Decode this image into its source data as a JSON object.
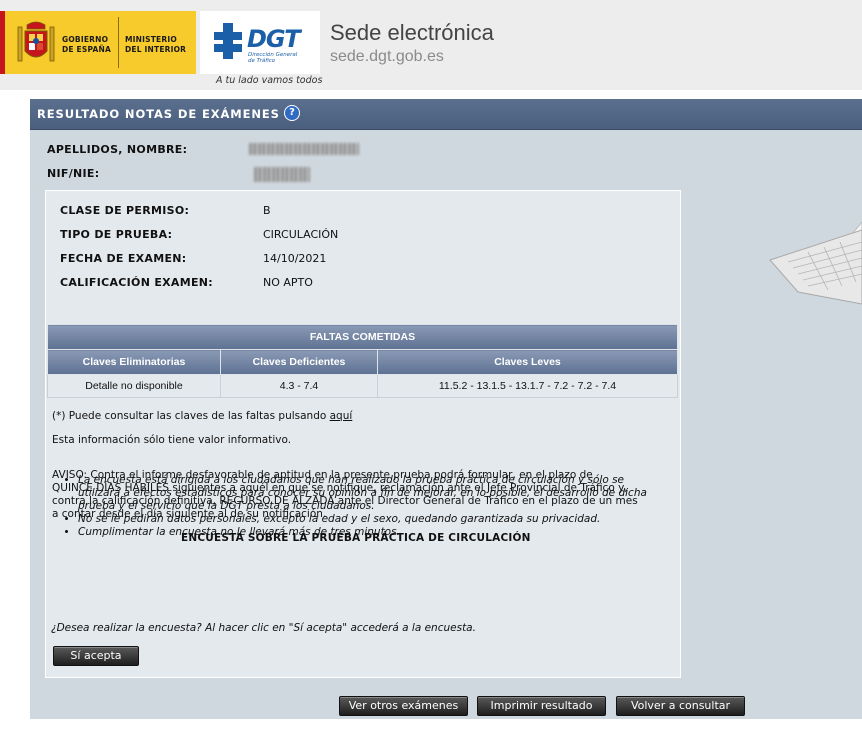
{
  "header": {
    "gov_left": "GOBIERNO\nDE ESPAÑA",
    "gov_right": "MINISTERIO\nDEL INTERIOR",
    "dgt_letters": "DGT",
    "dgt_sub": "Dirección General\nde Tráfico",
    "tagline": "A tu lado vamos todos",
    "sede_title": "Sede electrónica",
    "sede_url": "sede.dgt.gob.es"
  },
  "panel": {
    "title": "RESULTADO NOTAS DE EXÁMENES",
    "help_icon": "question-icon",
    "help_glyph": "?"
  },
  "person": {
    "name_label": "APELLIDOS, NOMBRE:",
    "nif_label": "NIF/NIE:"
  },
  "exam": {
    "permiso_label": "CLASE DE PERMISO:",
    "permiso_value": "B",
    "tipo_label": "TIPO DE PRUEBA:",
    "tipo_value": "CIRCULACIÓN",
    "fecha_label": "FECHA DE EXAMEN:",
    "fecha_value": "14/10/2021",
    "calif_label": "CALIFICACIÓN EXAMEN:",
    "calif_value": "NO APTO"
  },
  "faltas": {
    "title": "FALTAS COMETIDAS",
    "headers": [
      "Claves Eliminatorias",
      "Claves Deficientes",
      "Claves Leves"
    ],
    "row": [
      "Detalle no disponible",
      "4.3 - 7.4",
      "11.5.2 - 13.1.5 - 13.1.7 - 7.2 - 7.2 - 7.4"
    ]
  },
  "info": {
    "consult_prefix": "(*) Puede consultar las claves de las faltas pulsando ",
    "consult_link": "aquí",
    "informative": "Esta información sólo tiene valor informativo.",
    "aviso": [
      "AVISO: Contra el informe desfavorable de aptitud en la presente prueba podrá formular, en el plazo de",
      "QUINCE DÍAS HÁBILES siguientes a aquél en que se notifique, reclamación ante el Jefe Provincial de Tráfico y,",
      "contra la calificación definitiva, RECURSO DE ALZADA ante el Director General de Tráfico en el plazo de un mes",
      "a contar desde el día siguiente al de su notificación."
    ]
  },
  "survey": {
    "title": "ENCUESTA SOBRE LA PRUEBA PRÁCTICA DE CIRCULACIÓN",
    "bullets": [
      "La encuesta está dirigida a los ciudadanos que han realizado la prueba práctica de circulación y sólo se utilizará a efectos estadísticos para conocer su opinión a fin de mejorar, en lo posible, el desarrollo de dicha prueba y el servicio que la DGT presta a los ciudadanos.",
      "No se le pedirán datos personales, excepto la edad y el sexo, quedando garantizada su privacidad.",
      "Cumplimentar la encuesta no le llevará más de tres minutos."
    ],
    "question": "¿Desea realizar la encuesta? Al hacer clic en \"Sí acepta\" accederá a la encuesta.",
    "accept_button": "Sí acepta"
  },
  "buttons": {
    "other_exams": "Ver otros exámenes",
    "print": "Imprimir resultado",
    "back": "Volver a consultar"
  },
  "colors": {
    "panel_bg": "#cfd8df",
    "header_bar": "#4a5e7e",
    "gov_yellow": "#f7cb2b",
    "dgt_blue": "#1a5fa8"
  }
}
